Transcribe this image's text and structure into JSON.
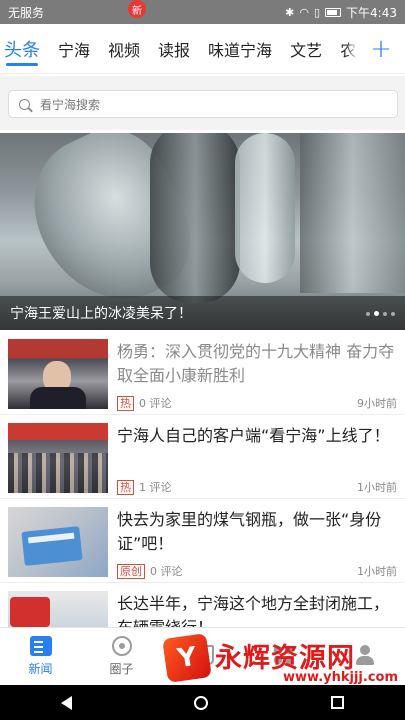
{
  "status_bar": {
    "carrier": "无服务",
    "time": "下午4:43"
  },
  "tabs": [
    {
      "label": "头条",
      "active": true
    },
    {
      "label": "宁海",
      "active": false
    },
    {
      "label": "视频",
      "active": false
    },
    {
      "label": "读报",
      "active": false
    },
    {
      "label": "味道宁海",
      "active": false
    },
    {
      "label": "文艺",
      "active": false
    },
    {
      "label": "农",
      "active": false
    }
  ],
  "tab_add_label": "+",
  "search": {
    "placeholder": "看宁海搜索"
  },
  "banner": {
    "caption": "宁海王爱山上的冰凌美呆了！",
    "slides": 4,
    "current_slide": 2
  },
  "news": [
    {
      "title": "杨勇：深入贯彻党的十九大精神 奋力夺取全面小康新胜利",
      "tag": "热",
      "comments": "0 评论",
      "time": "9小时前",
      "read": true
    },
    {
      "title": "宁海人自己的客户端“看宁海”上线了！",
      "tag": "热",
      "comments": "1 评论",
      "time": "1小时前",
      "read": false
    },
    {
      "title": "快去为家里的煤气钢瓶，做一张“身份证”吧！",
      "tag": "原创",
      "comments": "0 评论",
      "time": "1小时前",
      "read": false
    },
    {
      "title": "长达半年，宁海这个地方全封闭施工，车辆需绕行！",
      "tag": "",
      "comments": "",
      "time": "",
      "read": false
    }
  ],
  "bottom_nav": [
    {
      "label": "新闻",
      "icon": "news-icon",
      "active": true
    },
    {
      "label": "圈子",
      "icon": "circle-icon",
      "active": false,
      "badge": "新"
    },
    {
      "label": "",
      "icon": "bag-icon",
      "active": false
    },
    {
      "label": "",
      "icon": "grid-icon",
      "active": false
    },
    {
      "label": "",
      "icon": "user-icon",
      "active": false
    }
  ],
  "watermark": {
    "logo": "Y",
    "name": "永辉资源网",
    "url": "www.yhkjjj.com"
  },
  "colors": {
    "accent": "#2a7ff0",
    "hot_tag": "#e04a3b",
    "watermark": "#e01b1b"
  }
}
